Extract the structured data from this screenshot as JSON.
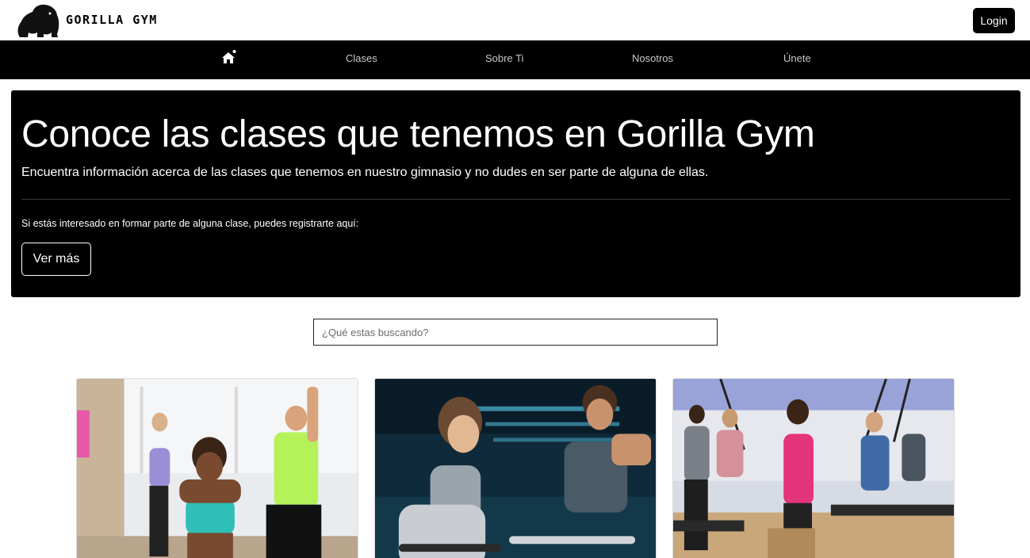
{
  "header": {
    "brand": "GORILLA GYM",
    "logo_icon": "gorilla-logo-icon",
    "login_label": "Login"
  },
  "nav": {
    "home_icon": "home-icon",
    "links": [
      "Clases",
      "Sobre Ti",
      "Nosotros",
      "Únete"
    ]
  },
  "hero": {
    "title": "Conoce las clases que tenemos en Gorilla Gym",
    "subtitle": "Encuentra información acerca de las clases que tenemos en nuestro gimnasio y no dudes en ser parte de alguna de ellas.",
    "note": "Si estás interesado en formar parte de alguna clase, puedes registrarte aquí:",
    "button_label": "Ver más"
  },
  "search": {
    "placeholder": "¿Qué estas buscando?",
    "value": ""
  },
  "cards": [
    {
      "image": "dance-aerobics-class-photo"
    },
    {
      "image": "spinning-class-photo"
    },
    {
      "image": "pilates-trx-class-photo"
    }
  ],
  "colors": {
    "primary": "#000000",
    "background": "#ffffff",
    "nav_text": "#c8c8c8"
  }
}
